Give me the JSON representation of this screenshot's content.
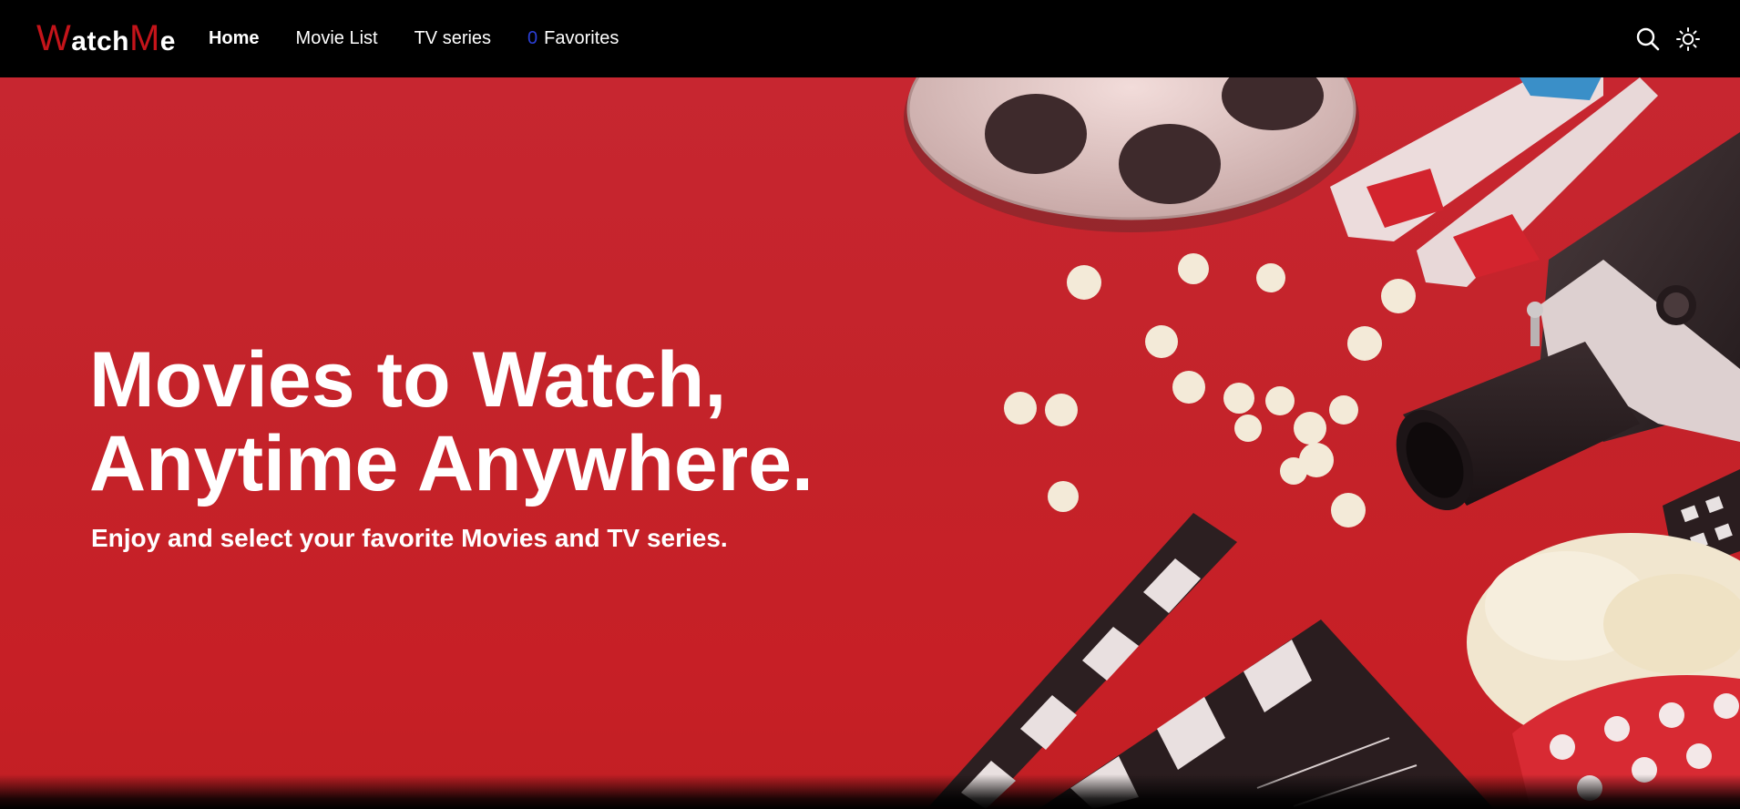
{
  "brand": {
    "logo_first_initial": "W",
    "logo_first_rest": "atch",
    "logo_second_initial": "M",
    "logo_second_rest": "e",
    "accent_color": "#c4141a"
  },
  "nav": {
    "items": [
      {
        "label": "Home",
        "active": true
      },
      {
        "label": "Movie List",
        "active": false
      },
      {
        "label": "TV series",
        "active": false
      }
    ],
    "favorites": {
      "count": "0",
      "label": "Favorites",
      "count_color": "#2b3fd6"
    }
  },
  "icons": {
    "search": "search-icon",
    "theme": "sun-icon"
  },
  "hero": {
    "title_line1": "Movies to Watch,",
    "title_line2": "Anytime Anywhere.",
    "subtitle": "Enjoy and select your favorite Movies and TV series.",
    "background_color": "#c4232a"
  }
}
